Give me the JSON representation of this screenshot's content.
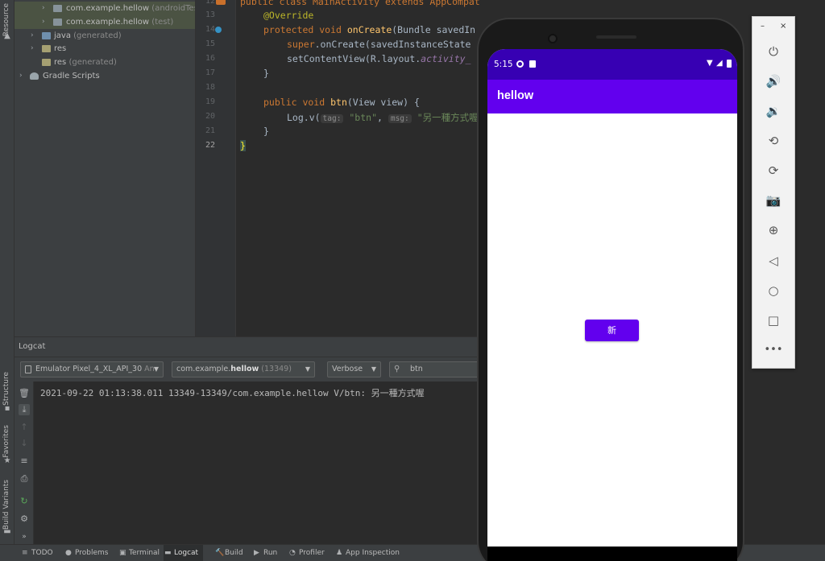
{
  "left_stripe": {
    "resource_label": "Resource",
    "structure_label": "Structure",
    "favorites_label": "Favorites",
    "build_variants_label": "Build Variants"
  },
  "project_tree": {
    "items": [
      {
        "label": "com.example.hellow",
        "suffix": "(androidTest)"
      },
      {
        "label": "com.example.hellow",
        "suffix": "(test)"
      },
      {
        "label": "java",
        "suffix": "(generated)"
      },
      {
        "label": "res",
        "suffix": ""
      },
      {
        "label": "res",
        "suffix": "(generated)"
      },
      {
        "label": "Gradle Scripts",
        "suffix": ""
      }
    ]
  },
  "editor": {
    "line_numbers": [
      "12",
      "13",
      "14",
      "15",
      "16",
      "17",
      "18",
      "19",
      "20",
      "21",
      "22"
    ],
    "lines": {
      "l12": "public class MainActivity extends AppCompatActivity {",
      "l13": "@Override",
      "l14_kw": "protected void ",
      "l14_fn": "onCreate",
      "l14_rest": "(Bundle savedIn",
      "l15_kw": "super",
      "l15_rest": ".onCreate(savedInstanceState",
      "l16_rest": "setContentView(R.layout.",
      "l16_it": "activity_",
      "l17": "}",
      "l19_kw": "public void ",
      "l19_fn": "btn",
      "l19_rest": "(View view) {",
      "l20_a": "Log.v(",
      "l20_tag": "tag:",
      "l20_btn": "\"btn\"",
      "l20_msg": "msg:",
      "l20_str": "\"另一種方式喔\"",
      "l21": "}",
      "l22": "}"
    }
  },
  "logcat": {
    "title": "Logcat",
    "device_combo": "Emulator Pixel_4_XL_API_30",
    "device_combo_suffix": "An",
    "process_prefix": "com.example.",
    "process_bold": "hellow",
    "process_pid": "(13349)",
    "level": "Verbose",
    "search_value": "btn",
    "log_line": "2021-09-22 01:13:38.011 13349-13349/com.example.hellow V/btn: 另一種方式喔"
  },
  "bottom_tabs": [
    {
      "label": "TODO"
    },
    {
      "label": "Problems"
    },
    {
      "label": "Terminal"
    },
    {
      "label": "Logcat"
    },
    {
      "label": "Build"
    },
    {
      "label": "Run"
    },
    {
      "label": "Profiler"
    },
    {
      "label": "App Inspection"
    }
  ],
  "emulator": {
    "status_time": "5:15",
    "app_title": "hellow",
    "button_label": "新",
    "colors": {
      "status_bar": "#3700b3",
      "app_bar": "#6200ee",
      "button": "#6200ee"
    }
  },
  "emulator_panel": {
    "minimize": "–",
    "close": "×",
    "icons": [
      "power-icon",
      "volume-up-icon",
      "volume-down-icon",
      "rotate-left-icon",
      "rotate-right-icon",
      "camera-icon",
      "zoom-icon",
      "back-icon",
      "home-icon",
      "overview-icon",
      "more-icon"
    ]
  }
}
